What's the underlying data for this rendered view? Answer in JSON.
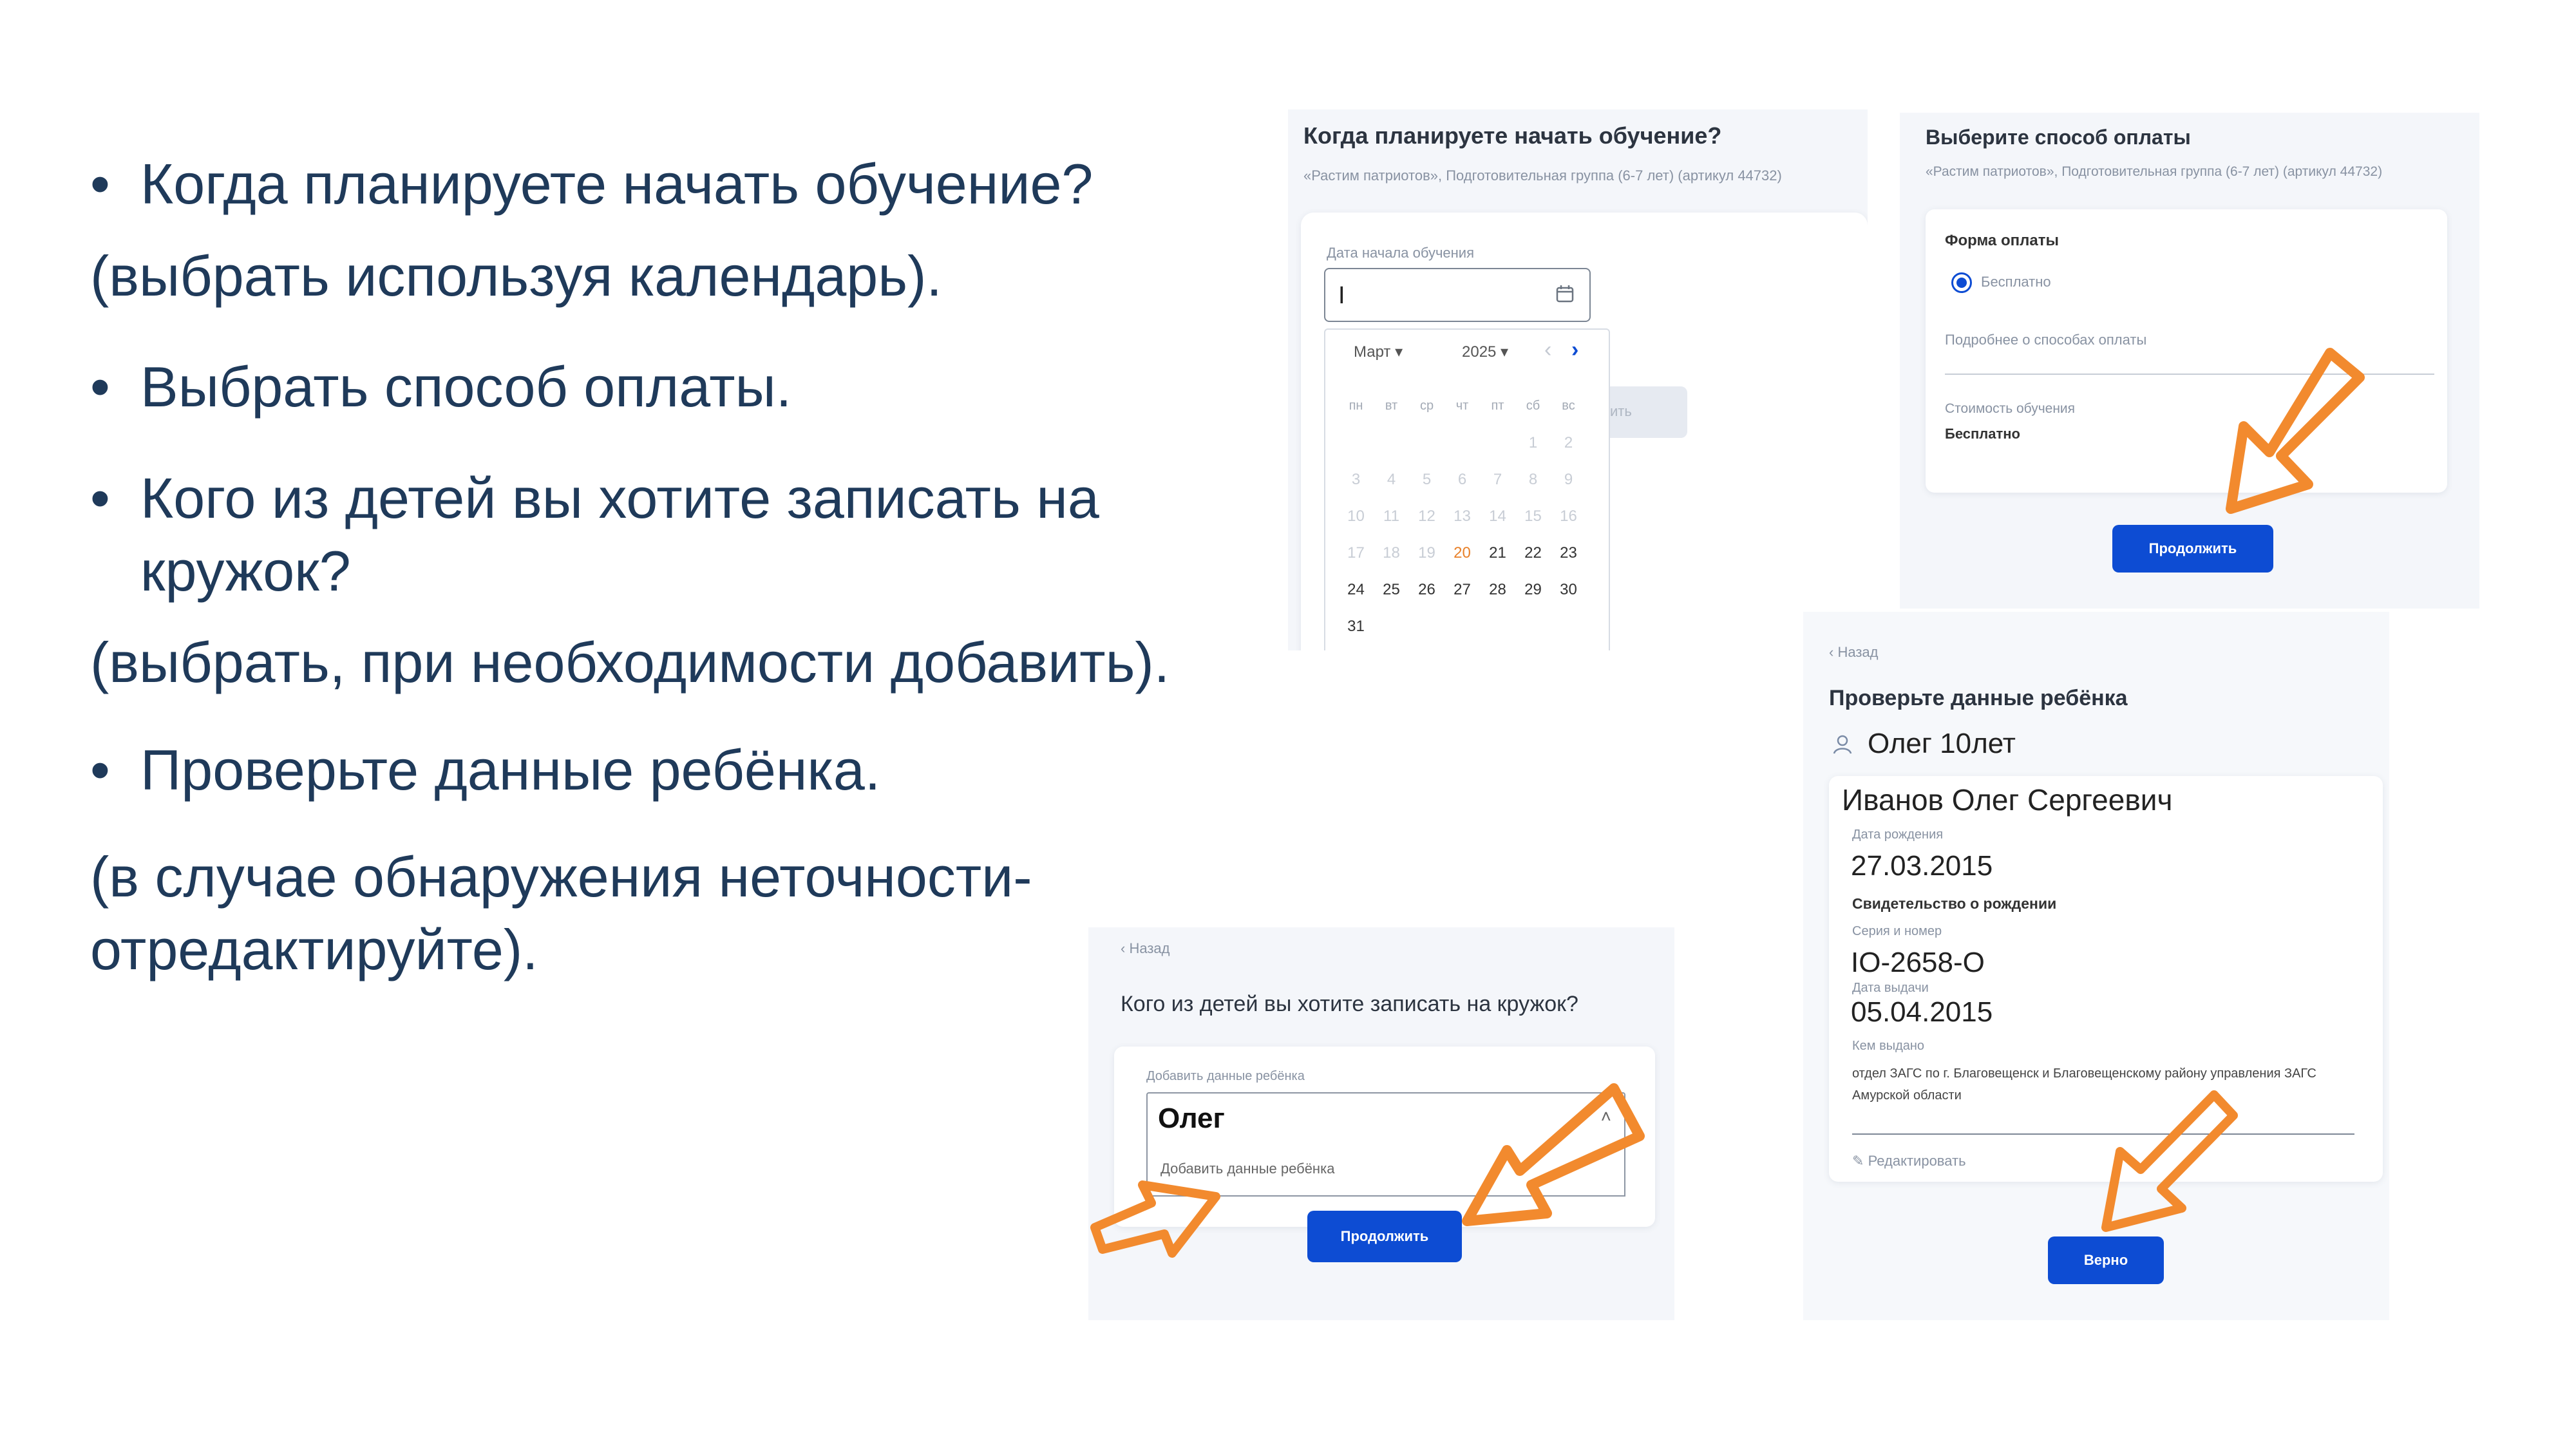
{
  "left_text": {
    "b1": "Когда планируете начать обучение?",
    "p1": "(выбрать используя календарь).",
    "b2": "Выбрать способ оплаты.",
    "b3a": "Кого из детей вы хотите записать на",
    "b3b": "кружок?",
    "p3": "(выбрать, при необходимости добавить).",
    "b4": "Проверьте данные ребёнка.",
    "p4a": "(в случае обнаружения неточности-",
    "p4b": "отредактируйте)."
  },
  "date_panel": {
    "title": "Когда планируете начать обучение?",
    "subtitle": "«Растим патриотов», Подготовительная группа (6-7 лет) (артикул 44732)",
    "field_label": "Дата начала обучения",
    "field_value": "I",
    "month": "Март",
    "year": "2025",
    "ghost_button": "ить",
    "weekdays": [
      "пн",
      "вт",
      "ср",
      "чт",
      "пт",
      "сб",
      "вс"
    ],
    "days": [
      [
        "",
        "",
        "",
        "",
        "",
        "1",
        "2"
      ],
      [
        "3",
        "4",
        "5",
        "6",
        "7",
        "8",
        "9"
      ],
      [
        "10",
        "11",
        "12",
        "13",
        "14",
        "15",
        "16"
      ],
      [
        "17",
        "18",
        "19",
        "20",
        "21",
        "22",
        "23"
      ],
      [
        "24",
        "25",
        "26",
        "27",
        "28",
        "29",
        "30"
      ],
      [
        "31",
        "",
        "",
        "",
        "",
        "",
        ""
      ]
    ]
  },
  "payment_panel": {
    "title": "Выберите способ оплаты",
    "subtitle": "«Растим патриотов», Подготовительная группа (6-7 лет) (артикул 44732)",
    "form_label": "Форма оплаты",
    "radio_label": "Бесплатно",
    "more_label": "Подробнее о способах оплаты",
    "cost_label": "Стоимость обучения",
    "cost_value": "Бесплатно",
    "continue_label": "Продолжить"
  },
  "child_panel": {
    "back": "‹ Назад",
    "title": "Кого из детей вы хотите записать на кружок?",
    "field_label": "Добавить данные ребёнка",
    "selected": "Олег",
    "option": "Добавить данные ребёнка",
    "continue_label": "Продолжить"
  },
  "verify_panel": {
    "back": "‹ Назад",
    "title": "Проверьте данные ребёнка",
    "child_short": "Олег 10лет",
    "full_name": "Иванов Олег Сергеевич",
    "birth_label": "Дата рождения",
    "birth_date": "27.03.2015",
    "cert_title": "Свидетельство о рождении",
    "series_label": "Серия и номер",
    "series_value": "IO-2658-O",
    "issue_label": "Дата выдачи",
    "issue_date": "05.04.2015",
    "issuer_label": "Кем выдано",
    "issuer_value": "отдел ЗАГС по г. Благовещенск и Благовещенскому району управления ЗАГС Амурской области",
    "edit_label": "Редактировать",
    "confirm_label": "Верно"
  },
  "colors": {
    "accent": "#0d4cd3",
    "arrow": "#f28a2e",
    "text": "#1f3a5a",
    "today": "#e8812a"
  }
}
